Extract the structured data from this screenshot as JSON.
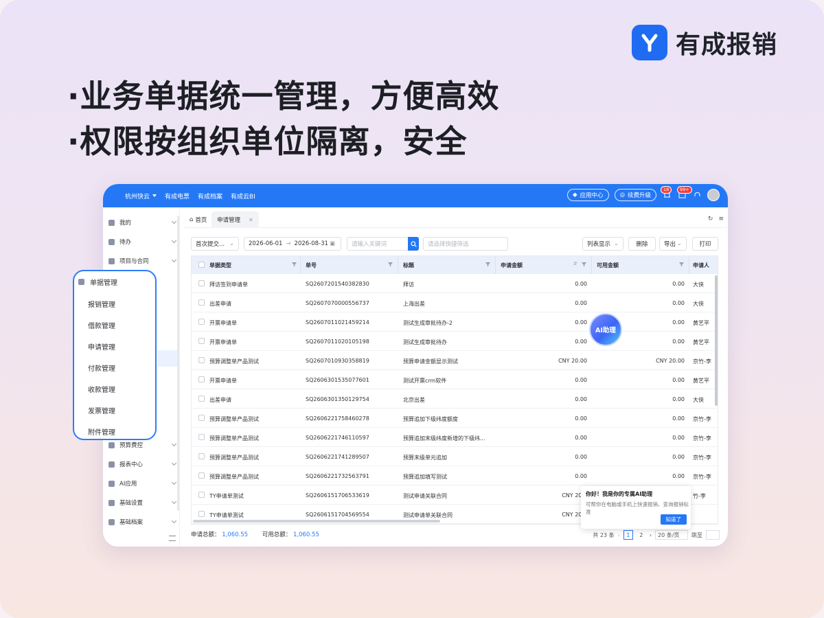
{
  "brand": {
    "name": "有成报销",
    "color": "#1f6cf2"
  },
  "headlines": [
    "·业务单据统一管理，方便高效",
    "·权限按组织单位隔离，安全"
  ],
  "topbar": {
    "org": "杭州快云",
    "nav": [
      "有成电票",
      "有成档案",
      "有成云BI"
    ],
    "app_center": "应用中心",
    "renew": "续费升级",
    "badge_a": "18",
    "badge_b": "99+",
    "color": "#2478f6"
  },
  "sidebar": {
    "items": [
      {
        "label": "我的",
        "icon": "user-icon"
      },
      {
        "label": "待办",
        "icon": "todo-icon"
      },
      {
        "label": "项目与合同",
        "icon": "contract-icon"
      },
      {
        "label": "预算费控",
        "icon": "budget-icon"
      },
      {
        "label": "报表中心",
        "icon": "report-icon"
      },
      {
        "label": "AI应用",
        "icon": "ai-icon"
      },
      {
        "label": "基础设置",
        "icon": "gear-icon"
      },
      {
        "label": "基础档案",
        "icon": "folder-icon"
      }
    ],
    "group": {
      "label": "单据管理",
      "children": [
        "报销管理",
        "借款管理",
        "申请管理",
        "付款管理",
        "收款管理",
        "发票管理",
        "附件管理"
      ]
    }
  },
  "tabs": {
    "home": "首页",
    "active": "申请管理"
  },
  "toolbar": {
    "date_filter": "首次提交...",
    "date_start": "2026-06-01",
    "date_end": "2026-08-31",
    "keyword_placeholder": "请输入关键词",
    "quick_filter_placeholder": "请选择快捷筛选",
    "list_display": "列表显示",
    "delete": "删除",
    "export": "导出",
    "print": "打印"
  },
  "table": {
    "columns": [
      "单据类型",
      "单号",
      "标题",
      "申请金额",
      "可用金额",
      "申请人"
    ],
    "rows": [
      [
        "拜访签到申请单",
        "SQ2607201540382830",
        "拜访",
        "0.00",
        "0.00",
        "大侠"
      ],
      [
        "出差申请",
        "SQ2607070000556737",
        "上海出差",
        "0.00",
        "0.00",
        "大侠"
      ],
      [
        "开票申请单",
        "SQ2607011021459214",
        "测试生成审批待办-2",
        "0.00",
        "0.00",
        "黄艺平"
      ],
      [
        "开票申请单",
        "SQ2607011020105198",
        "测试生成审批待办",
        "0.00",
        "0.00",
        "黄艺平"
      ],
      [
        "预算调整单产品测试",
        "SQ2607010930358819",
        "预算申请金额显示测试",
        "CNY 20.00",
        "CNY 20.00",
        "京竹-李"
      ],
      [
        "开票申请单",
        "SQ2606301535077601",
        "测试开票crm软件",
        "0.00",
        "0.00",
        "黄艺平"
      ],
      [
        "出差申请",
        "SQ2606301350129754",
        "北京出差",
        "0.00",
        "0.00",
        "大侠"
      ],
      [
        "预算调整单产品测试",
        "SQ2606221758460278",
        "预算追加下级纬度额度",
        "0.00",
        "0.00",
        "京竹-李"
      ],
      [
        "预算调整单产品测试",
        "SQ2606221746110597",
        "预算追加末级纬度新增的下级纬...",
        "0.00",
        "0.00",
        "京竹-李"
      ],
      [
        "预算调整单产品测试",
        "SQ2606221741289507",
        "预算末级单元追加",
        "0.00",
        "0.00",
        "京竹-李"
      ],
      [
        "预算调整单产品测试",
        "SQ2606221732563791",
        "预算追加填写测试",
        "0.00",
        "0.00",
        "京竹-李"
      ],
      [
        "TY申请单测试",
        "SQ2606151706533619",
        "测试申请关联合同",
        "CNY 200.",
        "",
        "竹-李"
      ],
      [
        "TY申请单测试",
        "SQ2606151704569554",
        "测试申请单关联合同",
        "CNY 200.",
        "",
        ""
      ]
    ]
  },
  "footer": {
    "apply_total_label": "申请总额：",
    "apply_total": "1,060.55",
    "available_total_label": "可用总额：",
    "available_total": "1,060.55",
    "total_count": "共 23 条",
    "pages": [
      "1",
      "2"
    ],
    "page_size": "20 条/页",
    "jump": "跳至"
  },
  "ai": {
    "title": "你好！我是你的专属AI助理",
    "desc": "可帮你在电脑或手机上快速报销、查询报销标准",
    "button": "知道了",
    "bubble": "AI助理"
  }
}
